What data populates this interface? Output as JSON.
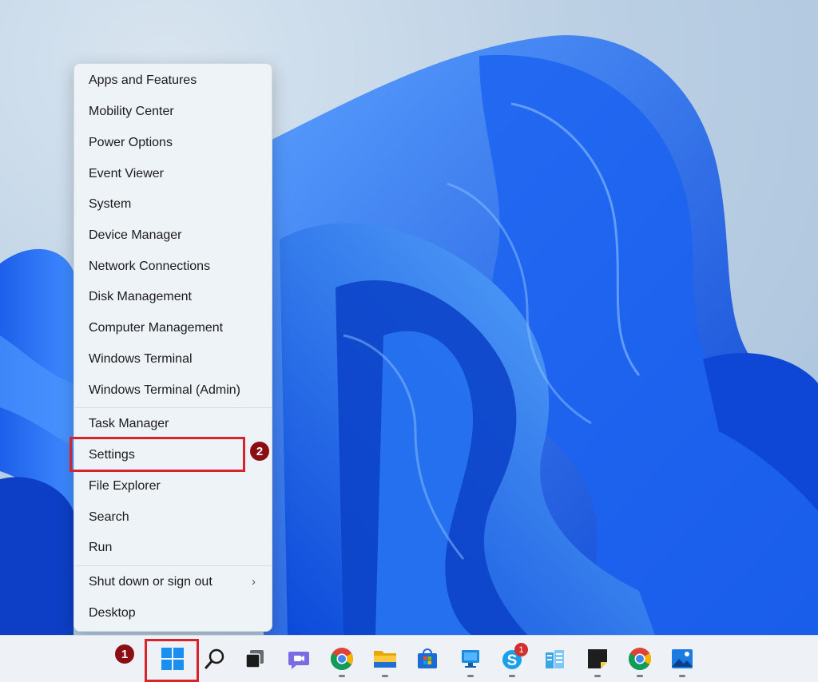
{
  "context_menu": {
    "group1": [
      "Apps and Features",
      "Mobility Center",
      "Power Options",
      "Event Viewer",
      "System",
      "Device Manager",
      "Network Connections",
      "Disk Management",
      "Computer Management",
      "Windows Terminal",
      "Windows Terminal (Admin)"
    ],
    "group2": [
      "Task Manager",
      "Settings",
      "File Explorer",
      "Search",
      "Run"
    ],
    "group3": [
      "Shut down or sign out",
      "Desktop"
    ]
  },
  "annotations": {
    "badge1": "1",
    "badge2": "2"
  },
  "taskbar": {
    "skype_badge": "1",
    "icons": [
      "windows-start-icon",
      "search-icon",
      "task-view-icon",
      "teams-chat-icon",
      "chrome-icon",
      "file-explorer-icon",
      "microsoft-store-icon",
      "remote-desktop-icon",
      "skype-icon",
      "azure-data-studio-icon",
      "sticky-notes-icon",
      "chrome-icon",
      "photos-icon"
    ]
  },
  "colors": {
    "accent": "#0a64e0",
    "annotation_red": "#d7232a",
    "badge": "#8b0f12"
  }
}
